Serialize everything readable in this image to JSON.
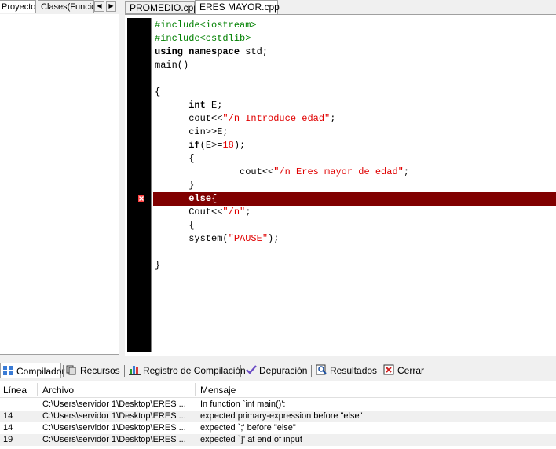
{
  "left_panel": {
    "tabs": [
      "Proyecto",
      "Clases(Funcic"
    ],
    "scroll_left": "◀",
    "scroll_right": "▶"
  },
  "editor": {
    "tabs": [
      {
        "label": "PROMEDIO.cpp",
        "active": false
      },
      {
        "label": "ERES MAYOR.cpp",
        "active": true
      }
    ],
    "error_line_index": 13,
    "colors": {
      "error_highlight": "#800000",
      "preprocessor": "#008000",
      "string": "#e00000"
    },
    "lines": [
      "#include<iostream>",
      "#include<cstdlib>",
      "using namespace std;",
      "main()",
      "",
      "{",
      "      int E;",
      "      cout<<\"/n Introduce edad\";",
      "      cin>>E;",
      "      if(E>=18);",
      "      {",
      "               cout<<\"/n Eres mayor de edad\";",
      "      }",
      "      else{",
      "      Cout<<\"/n\";",
      "      {",
      "      system(\"PAUSE\");",
      "",
      "}"
    ]
  },
  "bottom_tabs": [
    {
      "label": "Compilador",
      "icon": "compiler-grid-icon"
    },
    {
      "label": "Recursos",
      "icon": "resources-icon"
    },
    {
      "label": "Registro de Compilación",
      "icon": "bar-chart-icon"
    },
    {
      "label": "Depuración",
      "icon": "checkmark-icon"
    },
    {
      "label": "Resultados",
      "icon": "magnifier-icon"
    },
    {
      "label": "Cerrar",
      "icon": "close-icon"
    }
  ],
  "messages": {
    "columns": [
      "Línea",
      "Archivo",
      "Mensaje"
    ],
    "rows": [
      {
        "line": "",
        "file": "C:\\Users\\servidor 1\\Desktop\\ERES ...",
        "message": "In function `int main()':"
      },
      {
        "line": "14",
        "file": "C:\\Users\\servidor 1\\Desktop\\ERES ...",
        "message": "expected primary-expression before \"else\""
      },
      {
        "line": "14",
        "file": "C:\\Users\\servidor 1\\Desktop\\ERES ...",
        "message": "expected `;' before \"else\""
      },
      {
        "line": "19",
        "file": "C:\\Users\\servidor 1\\Desktop\\ERES ...",
        "message": "expected `}' at end of input"
      }
    ]
  }
}
